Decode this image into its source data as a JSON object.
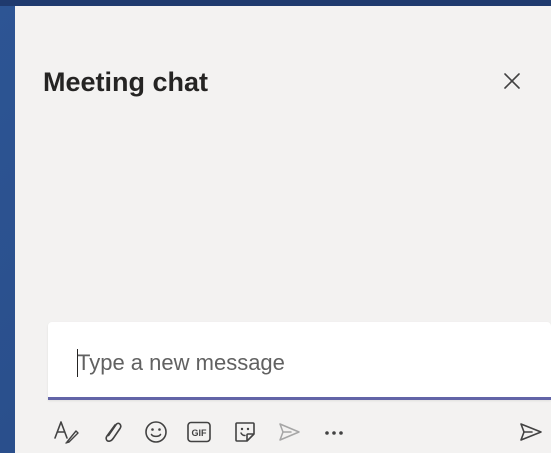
{
  "panel": {
    "title": "Meeting chat"
  },
  "compose": {
    "placeholder": "Type a new message"
  },
  "toolbar": {
    "gif_label": "GIF",
    "icons": [
      "format-icon",
      "attach-icon",
      "emoji-icon",
      "gif-icon",
      "sticker-icon",
      "praise-icon",
      "more-options-icon",
      "send-icon"
    ]
  },
  "colors": {
    "panel_bg": "#f3f2f1",
    "accent": "#6264a7",
    "text": "#252423",
    "icon": "#424242"
  }
}
